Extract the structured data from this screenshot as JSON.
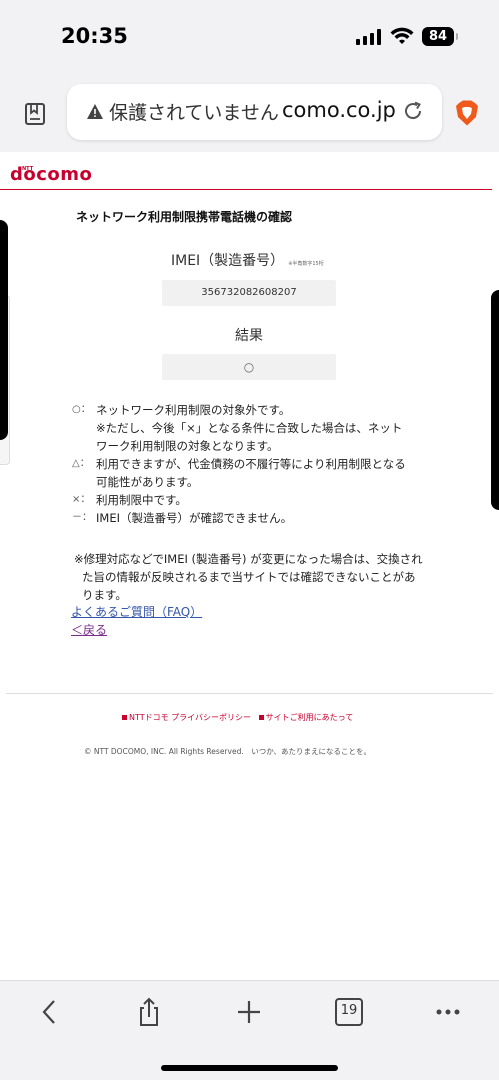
{
  "status": {
    "time": "20:35",
    "battery": "84"
  },
  "browser": {
    "url_security": "保護されていません",
    "url_domain": "como.co.jp",
    "tab_count": "19"
  },
  "brand": {
    "logo": "docomo",
    "logo_small": "NTT"
  },
  "page": {
    "title": "ネットワーク利用制限携帯電話機の確認",
    "imei_label": "IMEI（製造番号）",
    "imei_note": "※半角数字15桁",
    "imei_value": "356732082608207",
    "result_label": "結果",
    "result_value": "○",
    "legend": [
      {
        "symbol": "○：",
        "text": "ネットワーク利用制限の対象外です。"
      },
      {
        "symbol": "",
        "text": "※ただし、今後「×」となる条件に合致した場合は、ネット"
      },
      {
        "symbol": "",
        "text": "ワーク利用制限の対象となります。"
      },
      {
        "symbol": "△：",
        "text": "利用できますが、代金債務の不履行等により利用制限となる"
      },
      {
        "symbol": "",
        "text": "可能性があります。"
      },
      {
        "symbol": "×：",
        "text": "利用制限中です。"
      },
      {
        "symbol": "－：",
        "text": "IMEI（製造番号）が確認できません。"
      }
    ],
    "notice": [
      "※修理対応などでIMEI (製造番号) が変更になった場合は、交換され",
      "た旨の情報が反映されるまで当サイトでは確認できないことがあ",
      "ります。"
    ],
    "faq_link": "よくあるご質問（FAQ）",
    "back_link": "＜戻る"
  },
  "footer": {
    "privacy": "NTTドコモ プライバシーポリシー",
    "terms": "サイトご利用にあたって",
    "copyright": "© NTT DOCOMO, INC. All Rights Reserved.　いつか、あたりまえになることを。"
  },
  "colors": {
    "brand": "#c8002d",
    "link": "#3355aa",
    "visited": "#7a2a8a"
  }
}
